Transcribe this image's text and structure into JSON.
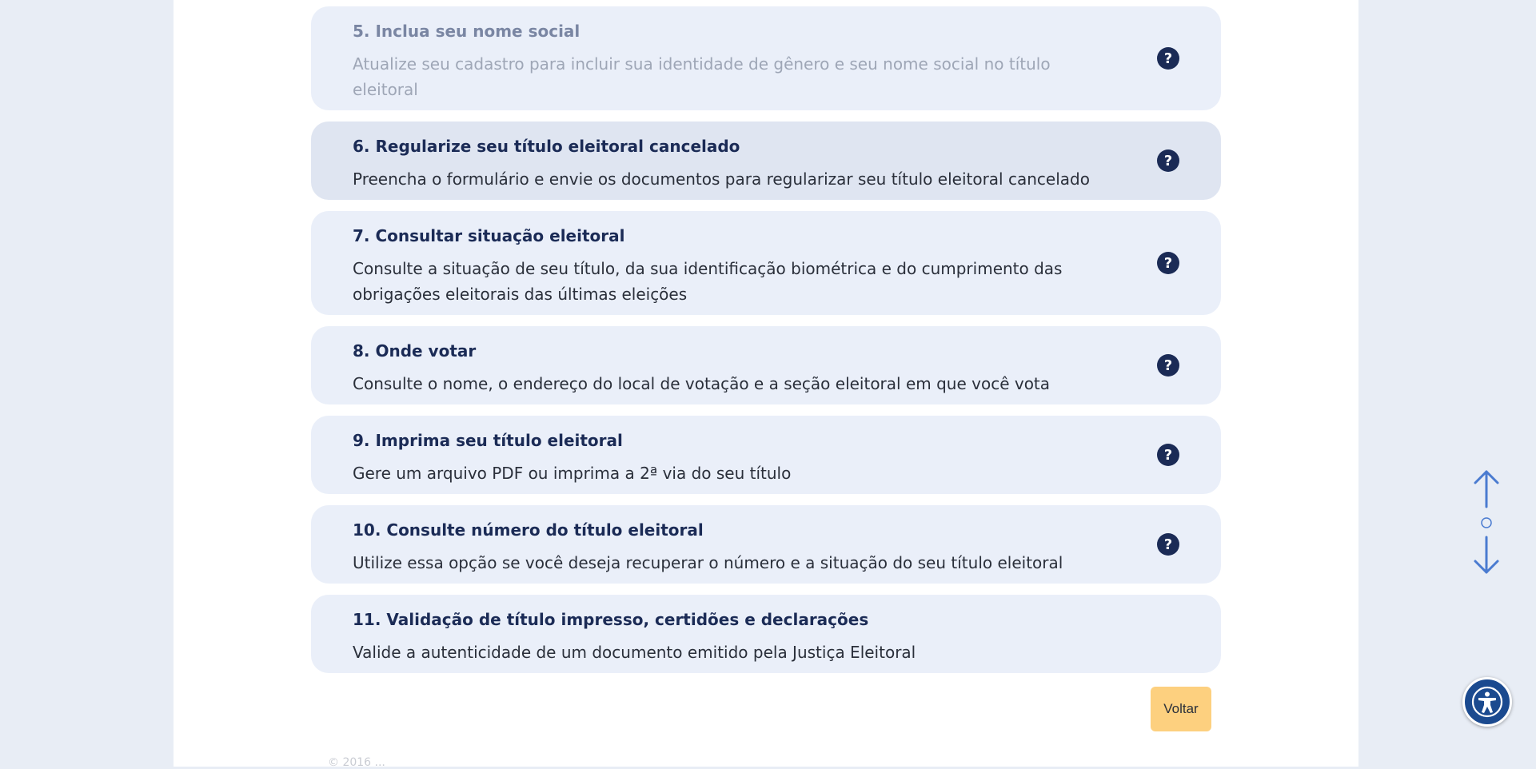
{
  "cards": [
    {
      "title": "5. Inclua seu nome social",
      "desc": "Atualize seu cadastro para incluir sua identidade de gênero e seu nome social no título eleitoral",
      "state": "faded",
      "help": true
    },
    {
      "title": "6. Regularize seu título eleitoral cancelado",
      "desc": "Preencha o formulário e envie os documentos para regularizar seu título eleitoral cancelado",
      "state": "hovered",
      "help": true
    },
    {
      "title": "7. Consultar situação eleitoral",
      "desc": "Consulte a situação de seu título, da sua identificação biométrica e do cumprimento das obrigações eleitorais das últimas eleições",
      "state": "normal",
      "help": true
    },
    {
      "title": "8. Onde votar",
      "desc": "Consulte o nome, o endereço do local de votação e a seção eleitoral em que você vota",
      "state": "normal",
      "help": true
    },
    {
      "title": "9. Imprima seu título eleitoral",
      "desc": "Gere um arquivo PDF ou imprima a 2ª via do seu título",
      "state": "normal",
      "help": true
    },
    {
      "title": "10. Consulte número do título eleitoral",
      "desc": "Utilize essa opção se você deseja recuperar o número e a situação do seu título eleitoral",
      "state": "normal",
      "help": true
    },
    {
      "title": "11. Validação de título impresso, certidões e declarações",
      "desc": "Valide a autenticidade de um documento emitido pela Justiça Eleitoral",
      "state": "normal",
      "help": false
    }
  ],
  "help_glyph": "?",
  "voltar_label": "Voltar",
  "footer_text": "© 2016 ...",
  "icons": {
    "help": "question-circle-icon",
    "scroll_up": "arrow-up-icon",
    "scroll_down": "arrow-down-icon",
    "accessibility": "accessibility-icon"
  },
  "colors": {
    "card_bg": "#eaeff9",
    "title": "#1b2b56",
    "button": "#fdd07f",
    "scroll_arrows": "#4a7bd0"
  }
}
